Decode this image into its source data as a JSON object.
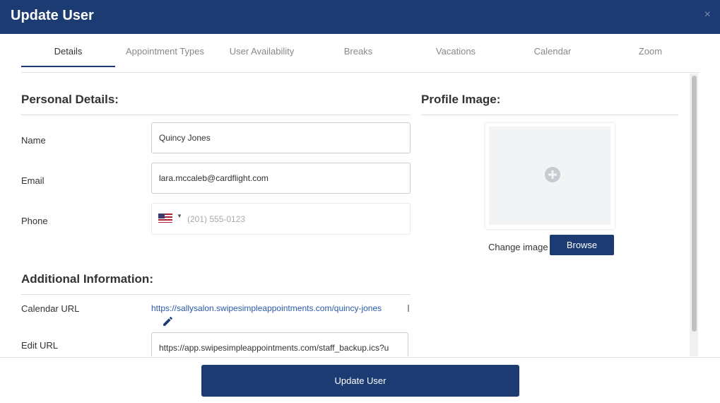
{
  "window": {
    "title": "Update User",
    "close_glyph": "×"
  },
  "tabs": [
    {
      "label": "Details",
      "active": true
    },
    {
      "label": "Appointment Types",
      "active": false
    },
    {
      "label": "User Availability",
      "active": false
    },
    {
      "label": "Breaks",
      "active": false
    },
    {
      "label": "Vacations",
      "active": false
    },
    {
      "label": "Calendar",
      "active": false
    },
    {
      "label": "Zoom",
      "active": false
    }
  ],
  "personal": {
    "title": "Personal Details:",
    "name_label": "Name",
    "name_value": "Quincy Jones",
    "email_label": "Email",
    "email_value": "lara.mccaleb@cardflight.com",
    "phone_label": "Phone",
    "phone_country_icon": "us-flag-icon",
    "phone_placeholder": "(201) 555-0123",
    "phone_value": ""
  },
  "additional": {
    "title": "Additional Information:",
    "calendar_url_label": "Calendar URL",
    "calendar_url": "https://sallysalon.swipesimpleappointments.com/quincy-jones",
    "edit_url_label": "Edit URL",
    "edit_url_value": "https://app.swipesimpleappointments.com/staff_backup.ics?u"
  },
  "profile": {
    "title": "Profile Image:",
    "change_label": "Change image",
    "browse_label": "Browse"
  },
  "footer": {
    "update_label": "Update User"
  },
  "colors": {
    "brand": "#1c3b73",
    "link": "#2a5aa8",
    "placeholder_bg": "#f2f3f5"
  }
}
